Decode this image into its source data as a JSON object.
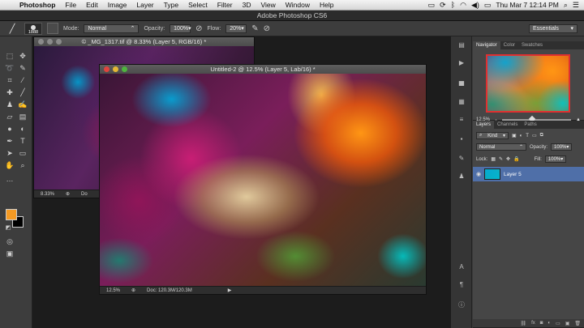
{
  "menubar": {
    "app": "Photoshop",
    "items": [
      "File",
      "Edit",
      "Image",
      "Layer",
      "Type",
      "Select",
      "Filter",
      "3D",
      "View",
      "Window",
      "Help"
    ],
    "datetime": "Thu Mar 7  12:14 PM"
  },
  "app_title": "Adobe Photoshop CS6",
  "options": {
    "brush_size": "1888",
    "mode_label": "Mode:",
    "mode_value": "Normal",
    "opacity_label": "Opacity:",
    "opacity_value": "100%",
    "flow_label": "Flow:",
    "flow_value": "20%",
    "workspace": "Essentials"
  },
  "back_doc": {
    "title": "© _MG_1317.tif @ 8.33% (Layer 5, RGB/16) *",
    "zoom": "8.33%",
    "doc_info": "Do"
  },
  "front_doc": {
    "title": "Untitled-2 @ 12.5% (Layer 5, Lab/16) *",
    "zoom": "12.5%",
    "doc_info": "Doc: 120.3M/120.3M"
  },
  "navigator": {
    "tabs": [
      "Navigator",
      "Color",
      "Swatches"
    ],
    "zoom": "12.5%"
  },
  "layers": {
    "tabs": [
      "Layers",
      "Channels",
      "Paths"
    ],
    "kind_label": "Kind",
    "blend_mode": "Normal",
    "opacity_label": "Opacity:",
    "opacity_value": "100%",
    "lock_label": "Lock:",
    "fill_label": "Fill:",
    "fill_value": "100%",
    "items": [
      {
        "name": "Layer 5"
      }
    ]
  },
  "colors": {
    "foreground": "#f59a23",
    "background": "#000000"
  }
}
